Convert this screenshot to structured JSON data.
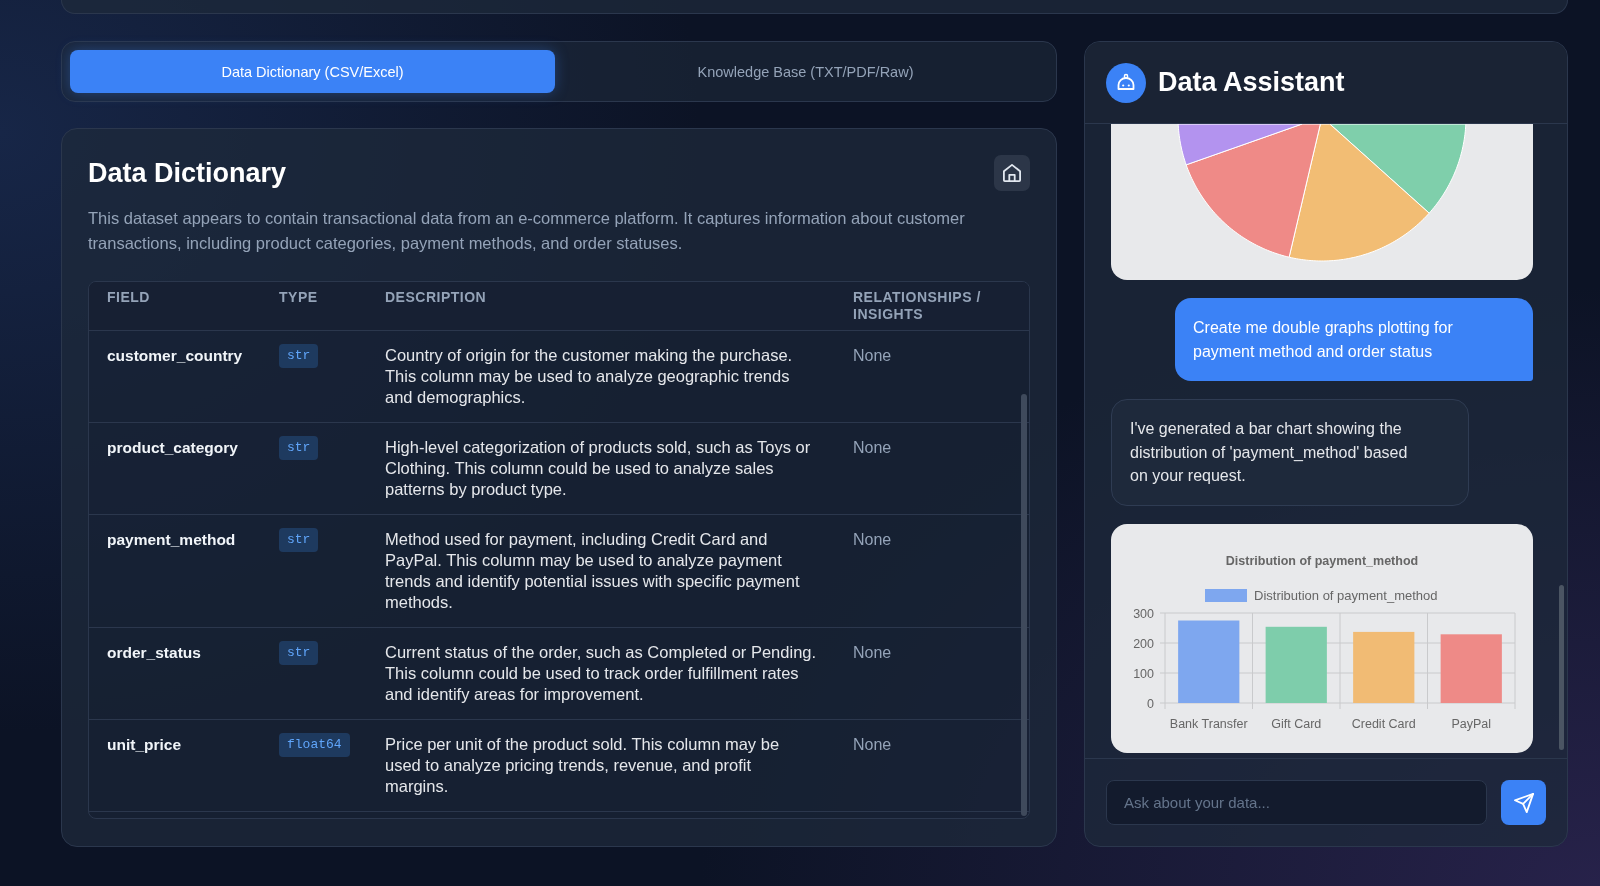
{
  "tabs": [
    {
      "label": "Data Dictionary (CSV/Excel)",
      "selected": true
    },
    {
      "label": "Knowledge Base (TXT/PDF/Raw)",
      "selected": false
    }
  ],
  "dictionary": {
    "title": "Data Dictionary",
    "description": "This dataset appears to contain transactional data from an e-commerce platform. It captures information about customer transactions, including product categories, payment methods, and order statuses.",
    "table": {
      "columns": [
        "FIELD",
        "TYPE",
        "DESCRIPTION",
        "RELATIONSHIPS / INSIGHTS"
      ],
      "rows": [
        {
          "field": "customer_country",
          "type": "str",
          "description": "Country of origin for the customer making the purchase. This column may be used to analyze geographic trends and demographics.",
          "relationships": "None"
        },
        {
          "field": "product_category",
          "type": "str",
          "description": "High-level categorization of products sold, such as Toys or Clothing. This column could be used to analyze sales patterns by product type.",
          "relationships": "None"
        },
        {
          "field": "payment_method",
          "type": "str",
          "description": "Method used for payment, including Credit Card and PayPal. This column may be used to analyze payment trends and identify potential issues with specific payment methods.",
          "relationships": "None"
        },
        {
          "field": "order_status",
          "type": "str",
          "description": "Current status of the order, such as Completed or Pending. This column could be used to track order fulfillment rates and identify areas for improvement.",
          "relationships": "None"
        },
        {
          "field": "unit_price",
          "type": "float64",
          "description": "Price per unit of the product sold. This column may be used to analyze pricing trends, revenue, and profit margins.",
          "relationships": "None"
        }
      ]
    }
  },
  "assistant": {
    "title": "Data Assistant",
    "messages": [
      {
        "kind": "pie_chart"
      },
      {
        "kind": "user",
        "text": "Create me double graphs plotting for payment method and order status"
      },
      {
        "kind": "assistant",
        "text": "I've generated a bar chart showing the distribution of 'payment_method' based on your request."
      },
      {
        "kind": "bar_chart",
        "chart_data": {
          "type": "bar",
          "title": "Distribution of payment_method",
          "categories": [
            "Bank Transfer",
            "Gift Card",
            "Credit Card",
            "PayPal"
          ],
          "series": [
            {
              "name": "Distribution of payment_method",
              "color": "#7ea7ef",
              "colors": [
                "#7ea7ef",
                "#7ecdab",
                "#f1bb74",
                "#ee8a87"
              ],
              "values": [
                275,
                254,
                237,
                229
              ]
            }
          ],
          "ylim": [
            0,
            300
          ],
          "yticks": [
            0,
            100,
            200,
            300
          ]
        }
      }
    ],
    "input": {
      "placeholder": "Ask about your data..."
    }
  }
}
